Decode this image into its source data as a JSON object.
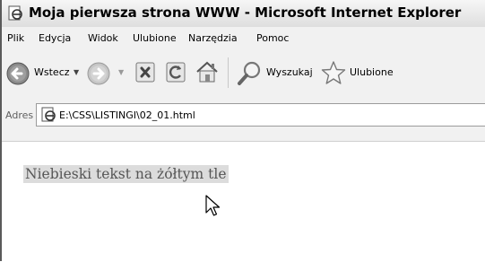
{
  "window": {
    "title": "Moja pierwsza strona WWW - Microsoft Internet Explorer"
  },
  "menu": {
    "items": [
      {
        "label": "Plik"
      },
      {
        "label": "Edycja"
      },
      {
        "label": "Widok"
      },
      {
        "label": "Ulubione"
      },
      {
        "label": "Narzędzia"
      },
      {
        "label": "Pomoc"
      }
    ]
  },
  "toolbar": {
    "back_label": "Wstecz",
    "search_label": "Wyszukaj",
    "favorites_label": "Ulubione"
  },
  "address": {
    "label": "Adres",
    "value": "E:\\CSS\\LISTINGI\\02_01.html"
  },
  "page": {
    "text": "Niebieski tekst na żółtym tle"
  },
  "icons": {
    "title": "ie-page-icon",
    "back": "back-arrow-icon",
    "forward": "forward-arrow-icon",
    "stop": "stop-icon",
    "refresh": "refresh-icon",
    "home": "home-icon",
    "search": "search-icon",
    "favorites": "favorites-star-icon",
    "cursor": "mouse-pointer-icon"
  }
}
